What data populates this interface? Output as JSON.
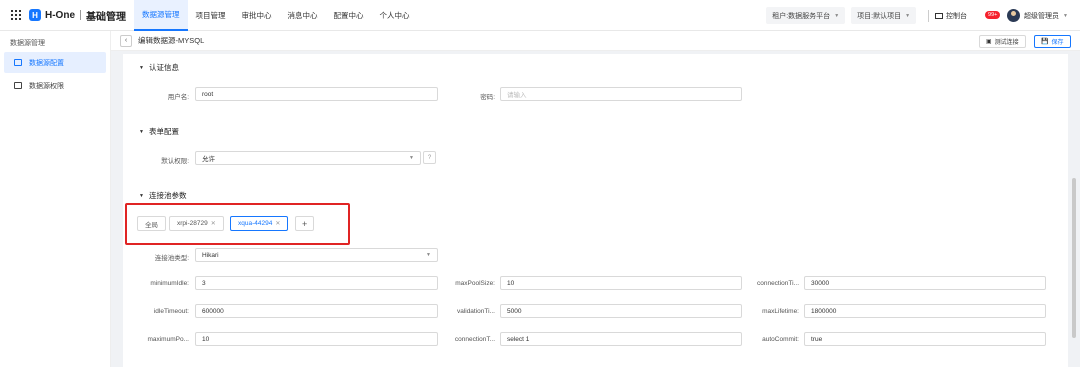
{
  "header": {
    "logo_mark": "H",
    "logo_text": "H-One",
    "logo_sub": "基础管理",
    "nav": [
      "数据源管理",
      "项目管理",
      "审批中心",
      "消息中心",
      "配置中心",
      "个人中心"
    ],
    "tenant": "租户:数据服务平台",
    "project": "项目:默认项目",
    "console": "控制台",
    "badge": "99+",
    "user": "超级管理员"
  },
  "sidebar": {
    "title": "数据源管理",
    "items": [
      "数据源配置",
      "数据源权限"
    ]
  },
  "page": {
    "title": "编辑数据源-MYSQL",
    "test_button": "测试连接",
    "save_button": "保存"
  },
  "auth": {
    "section": "认证信息",
    "username_label": "用户名:",
    "username_value": "root",
    "password_label": "密码:",
    "password_placeholder": "请输入"
  },
  "form_config": {
    "section": "表单配置",
    "default_perm_label": "默认权限:",
    "default_perm_value": "允许"
  },
  "pool": {
    "section": "连接池参数",
    "tabs": [
      "全局",
      "xrpi-28729",
      "xqua-44294",
      "+"
    ],
    "type_label": "连接池类型:",
    "type_value": "Hikari",
    "params": [
      {
        "label": "minimumIdle:",
        "value": "3"
      },
      {
        "label": "maxPoolSize:",
        "value": "10"
      },
      {
        "label": "connectionTi...",
        "value": "30000"
      },
      {
        "label": "idleTimeout:",
        "value": "600000"
      },
      {
        "label": "validationTi...",
        "value": "5000"
      },
      {
        "label": "maxLifetime:",
        "value": "1800000"
      },
      {
        "label": "maximumPo...",
        "value": "10"
      },
      {
        "label": "connectionT...",
        "value": "select 1"
      },
      {
        "label": "autoCommit:",
        "value": "true"
      }
    ]
  },
  "colors": {
    "accent": "#1677ff",
    "highlight": "#e02424",
    "badge": "#f5222d"
  }
}
